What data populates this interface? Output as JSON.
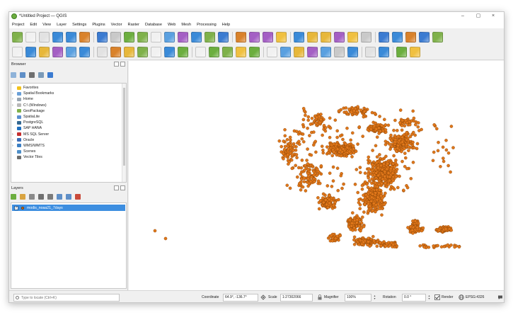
{
  "window": {
    "title": "*Untitled Project — QGIS"
  },
  "window_controls": {
    "minimize": "–",
    "maximize": "▢",
    "close": "×"
  },
  "menu": [
    "Project",
    "Edit",
    "View",
    "Layer",
    "Settings",
    "Plugins",
    "Vector",
    "Raster",
    "Database",
    "Web",
    "Mesh",
    "Processing",
    "Help"
  ],
  "toolbar1_icons": [
    "new-project-icon",
    "open-project-icon",
    "save-project-icon",
    "save-as-icon",
    "print-layout-icon",
    "style-manager-icon",
    "pan-icon",
    "pan-to-selection-icon",
    "zoom-in-icon",
    "zoom-out-icon",
    "zoom-full-icon",
    "zoom-to-selection-icon",
    "zoom-to-layer-icon",
    "zoom-last-icon",
    "zoom-next-icon",
    "new-map-view-icon",
    "bookmark-icon",
    "show-bookmarks-icon",
    "temporal-controller-icon",
    "refresh-icon",
    "identify-icon",
    "select-features-icon",
    "deselect-icon",
    "select-by-expression-icon",
    "open-attribute-table-icon",
    "statistics-icon",
    "toolbox-icon",
    "measure-icon",
    "map-tips-icon",
    "annotation-icon",
    "label-icon"
  ],
  "toolbar2_icons": [
    "data-source-manager-icon",
    "new-layer-icon",
    "add-vector-layer-icon",
    "add-raster-layer-icon",
    "add-delimited-text-icon",
    "add-virtual-layer-icon",
    "digitize-icon",
    "edit-pencil-icon",
    "save-edits-icon",
    "add-line-icon",
    "add-point-icon",
    "vertex-tool-icon",
    "delete-selected-icon",
    "cut-features-icon",
    "copy-features-icon",
    "paste-features-icon",
    "undo-icon",
    "redo-icon",
    "label-toolbar-icon",
    "pin-label-icon",
    "show-label-icon",
    "move-label-icon",
    "rotate-label-icon",
    "change-label-icon",
    "label-properties-icon",
    "diagram-icon",
    "python-console-icon",
    "plugin-icon",
    "help-icon"
  ],
  "browser": {
    "title": "Browser",
    "toolbar_icons": [
      "add-selected-layers-icon",
      "refresh-browser-icon",
      "filter-browser-icon",
      "collapse-all-icon",
      "properties-icon"
    ],
    "items": [
      {
        "label": "Favorites",
        "icon": "star-icon",
        "color": "#f2c21b",
        "expandable": false
      },
      {
        "label": "Spatial Bookmarks",
        "icon": "bookmarks-icon",
        "color": "#6aa0d8",
        "expandable": true
      },
      {
        "label": "Home",
        "icon": "home-folder-icon",
        "color": "#9aa6b2",
        "expandable": true
      },
      {
        "label": "C:\\ (Windows)",
        "icon": "drive-icon",
        "color": "#b8b8b8",
        "expandable": true
      },
      {
        "label": "GeoPackage",
        "icon": "geopackage-icon",
        "color": "#7fb14a",
        "expandable": false
      },
      {
        "label": "SpatiaLite",
        "icon": "spatialite-icon",
        "color": "#5a8fd0",
        "expandable": false
      },
      {
        "label": "PostgreSQL",
        "icon": "postgresql-icon",
        "color": "#336791",
        "expandable": false
      },
      {
        "label": "SAP HANA",
        "icon": "sap-hana-icon",
        "color": "#1f6fbf",
        "expandable": false
      },
      {
        "label": "MS SQL Server",
        "icon": "mssql-icon",
        "color": "#c62f2f",
        "expandable": true
      },
      {
        "label": "Oracle",
        "icon": "oracle-icon",
        "color": "#3a6db8",
        "expandable": true
      },
      {
        "label": "WMS/WMTS",
        "icon": "wms-icon",
        "color": "#3b7fc4",
        "expandable": true
      },
      {
        "label": "Scenes",
        "icon": "scenes-icon",
        "color": "#4e8fc9",
        "expandable": false
      },
      {
        "label": "Vector Tiles",
        "icon": "vector-tiles-icon",
        "color": "#6d6d6d",
        "expandable": false
      }
    ]
  },
  "layers": {
    "title": "Layers",
    "toolbar_icons": [
      "open-layer-styling-icon",
      "add-group-icon",
      "manage-map-themes-icon",
      "filter-legend-icon",
      "filter-by-expression-icon",
      "expand-all-icon",
      "collapse-all-layers-icon",
      "remove-layer-icon"
    ],
    "items": [
      {
        "name": "modis_noaa21_7days",
        "checked": true,
        "symbol_color": "#e0771a"
      }
    ]
  },
  "map": {
    "point_color": "#e0771a",
    "point_stroke": "#7a3a00",
    "background": "#ffffff"
  },
  "status": {
    "locator_placeholder": "Type to locate (Ctrl+K)",
    "coordinate_label": "Coordinate",
    "coordinate": "64.9°, -136.7°",
    "scale_label": "Scale",
    "scale": "1:27302066",
    "magnifier_label": "Magnifier",
    "magnifier": "100%",
    "rotation_label": "Rotation",
    "rotation": "0.0 °",
    "render_label": "Render",
    "render_checked": true,
    "crs": "EPSG:4326"
  }
}
